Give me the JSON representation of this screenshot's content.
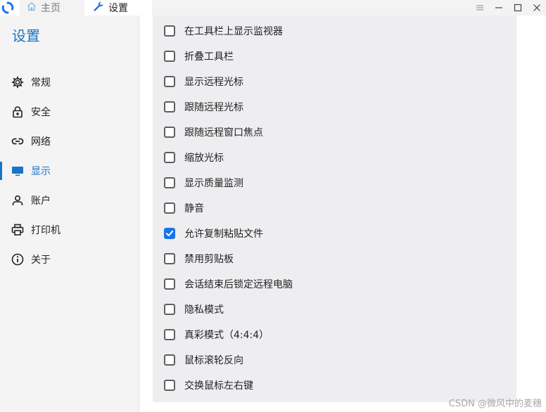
{
  "tabs": {
    "home_label": "主页",
    "settings_label": "设置"
  },
  "sidebar": {
    "title": "设置",
    "items": [
      {
        "label": "常规",
        "icon": "gear-icon"
      },
      {
        "label": "安全",
        "icon": "lock-icon"
      },
      {
        "label": "网络",
        "icon": "link-icon"
      },
      {
        "label": "显示",
        "icon": "monitor-icon",
        "active": true
      },
      {
        "label": "账户",
        "icon": "person-icon"
      },
      {
        "label": "打印机",
        "icon": "printer-icon"
      },
      {
        "label": "关于",
        "icon": "info-icon"
      }
    ]
  },
  "display_options": [
    {
      "label": "在工具栏上显示监视器",
      "checked": false
    },
    {
      "label": "折叠工具栏",
      "checked": false
    },
    {
      "label": "显示远程光标",
      "checked": false
    },
    {
      "label": "跟随远程光标",
      "checked": false
    },
    {
      "label": "跟随远程窗口焦点",
      "checked": false
    },
    {
      "label": "缩放光标",
      "checked": false
    },
    {
      "label": "显示质量监测",
      "checked": false
    },
    {
      "label": "静音",
      "checked": false
    },
    {
      "label": "允许复制粘贴文件",
      "checked": true
    },
    {
      "label": "禁用剪贴板",
      "checked": false
    },
    {
      "label": "会话结束后锁定远程电脑",
      "checked": false
    },
    {
      "label": "隐私模式",
      "checked": false
    },
    {
      "label": "真彩模式（4:4:4）",
      "checked": false
    },
    {
      "label": "鼠标滚轮反向",
      "checked": false
    },
    {
      "label": "交换鼠标左右键",
      "checked": false
    }
  ],
  "watermark": "CSDN @微风中的麦穗",
  "colors": {
    "accent": "#1a73c9",
    "checkbox_checked": "#1a73e8",
    "panel_bg": "#eeeef1",
    "sidebar_bg": "#f4f4f4"
  }
}
